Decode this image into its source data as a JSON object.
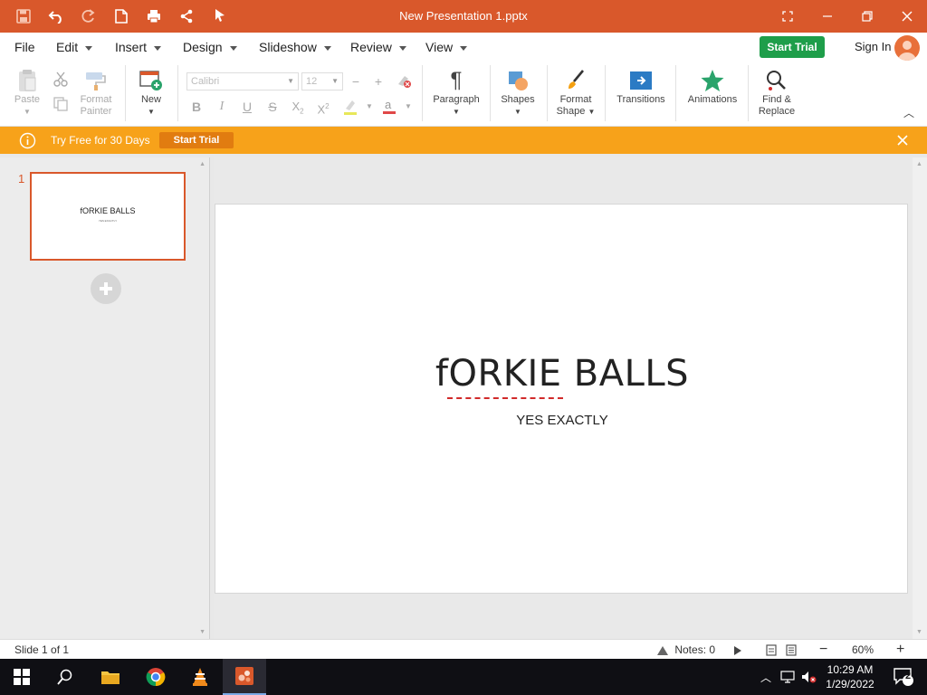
{
  "window": {
    "title": "New Presentation 1.pptx"
  },
  "menu": {
    "items": [
      {
        "label": "File"
      },
      {
        "label": "Edit"
      },
      {
        "label": "Insert"
      },
      {
        "label": "Design"
      },
      {
        "label": "Slideshow"
      },
      {
        "label": "Review"
      },
      {
        "label": "View"
      }
    ],
    "start_trial": "Start Trial",
    "sign_in": "Sign In"
  },
  "ribbon": {
    "paste": "Paste",
    "format_painter_1": "Format",
    "format_painter_2": "Painter",
    "new": "New",
    "font_name": "Calibri",
    "font_size": "12",
    "paragraph": "Paragraph",
    "shapes": "Shapes",
    "format_shape_1": "Format",
    "format_shape_2": "Shape",
    "transitions": "Transitions",
    "animations": "Animations",
    "find_replace_1": "Find &",
    "find_replace_2": "Replace"
  },
  "trial_bar": {
    "message": "Try Free for 30 Days",
    "button": "Start Trial"
  },
  "slides_pane": {
    "thumb_number": "1",
    "thumb_title": "fORKIE BALLS",
    "thumb_sub": "YES EXACTLY"
  },
  "slide": {
    "title": "fORKIE BALLS",
    "subtitle": "YES EXACTLY"
  },
  "status": {
    "slide_info": "Slide 1 of 1",
    "notes": "Notes: 0",
    "zoom": "60%"
  },
  "taskbar": {
    "time": "10:29 AM",
    "date": "1/29/2022",
    "notifications": "2"
  },
  "colors": {
    "accent": "#d9582b",
    "trial": "#f7a21a",
    "start_trial_green": "#1e9e4a"
  }
}
